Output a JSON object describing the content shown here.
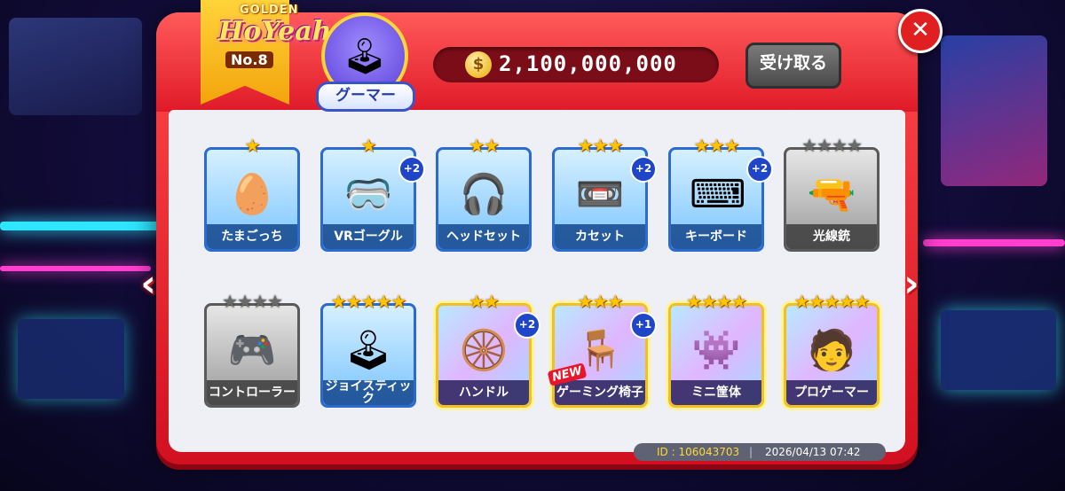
{
  "header": {
    "logo_top": "GOLDEN",
    "logo_main": "HoYeah",
    "number_label": "No.8",
    "avatar_label": "グーマー",
    "coins": "2,100,000,000",
    "claim_label": "受け取る",
    "close_label": "✕"
  },
  "nav": {
    "prev": "‹",
    "next": "›"
  },
  "cards": [
    {
      "label": "たまごっち",
      "stars": 1,
      "max": 1,
      "style": "blue",
      "icon": "tamagotchi-icon",
      "glyph": "🥚",
      "badge": ""
    },
    {
      "label": "VRゴーグル",
      "stars": 1,
      "max": 1,
      "style": "blue",
      "icon": "vr-goggles-icon",
      "glyph": "🥽",
      "badge": "+2"
    },
    {
      "label": "ヘッドセット",
      "stars": 2,
      "max": 2,
      "style": "blue",
      "icon": "headset-icon",
      "glyph": "🎧",
      "badge": ""
    },
    {
      "label": "カセット",
      "stars": 3,
      "max": 3,
      "style": "blue",
      "icon": "cassette-icon",
      "glyph": "📼",
      "badge": "+2"
    },
    {
      "label": "キーボード",
      "stars": 3,
      "max": 3,
      "style": "blue",
      "icon": "keyboard-icon",
      "glyph": "⌨",
      "badge": "+2"
    },
    {
      "label": "光線銃",
      "stars": 0,
      "max": 4,
      "style": "gray",
      "icon": "ray-gun-icon",
      "glyph": "🔫",
      "badge": ""
    },
    {
      "label": "コントローラー",
      "stars": 0,
      "max": 4,
      "style": "gray",
      "icon": "controller-icon",
      "glyph": "🎮",
      "badge": ""
    },
    {
      "label": "ジョイスティック",
      "stars": 5,
      "max": 5,
      "style": "blue",
      "icon": "joystick-icon",
      "glyph": "🕹",
      "badge": ""
    },
    {
      "label": "ハンドル",
      "stars": 2,
      "max": 2,
      "style": "gold",
      "icon": "steering-wheel-icon",
      "glyph": "🛞",
      "badge": "+2"
    },
    {
      "label": "ゲーミング椅子",
      "stars": 3,
      "max": 3,
      "style": "gold",
      "icon": "gaming-chair-icon",
      "glyph": "🪑",
      "badge": "+1",
      "new": "NEW"
    },
    {
      "label": "ミニ筐体",
      "stars": 4,
      "max": 4,
      "style": "gold",
      "icon": "mini-arcade-icon",
      "glyph": "👾",
      "badge": ""
    },
    {
      "label": "プロゲーマー",
      "stars": 5,
      "max": 5,
      "style": "gold",
      "icon": "pro-gamer-icon",
      "glyph": "🧑",
      "badge": ""
    }
  ],
  "footer": {
    "id_text": "ID : 106043703",
    "separator": "|",
    "datetime": "2026/04/13 07:42"
  }
}
